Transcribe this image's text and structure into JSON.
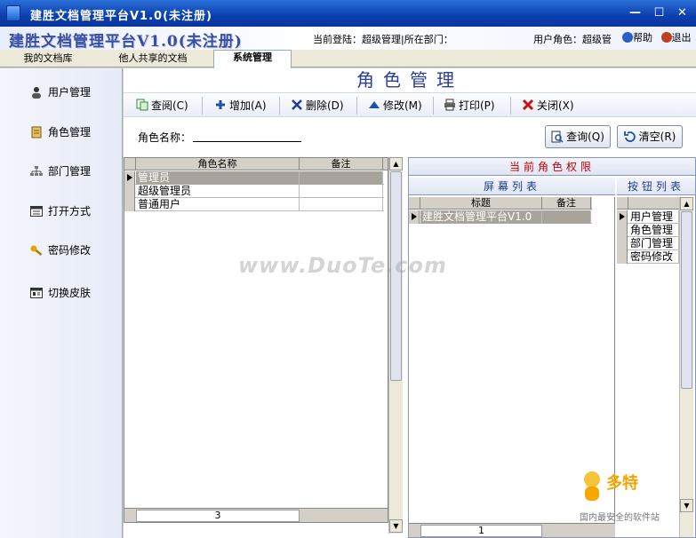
{
  "window": {
    "title": "建胜文档管理平台V1.0(未注册)",
    "min_glyph": "—",
    "max_glyph": "☐",
    "close_glyph": "✕"
  },
  "header": {
    "brand": "建胜文档管理平台V1.0(未注册)",
    "login_label": "当前登陆：",
    "login_user": "超级管理",
    "dept_label": "所在部门：",
    "role_label": "用户角色：",
    "role_value": "超级管",
    "help_label": "帮助",
    "exit_label": "退出"
  },
  "tabs": [
    {
      "label": "我的文档库"
    },
    {
      "label": "他人共享的文档"
    },
    {
      "label": "系统管理"
    }
  ],
  "sidebar": {
    "items": [
      {
        "label": "用户管理",
        "icon": "user-icon"
      },
      {
        "label": "角色管理",
        "icon": "role-icon"
      },
      {
        "label": "部门管理",
        "icon": "org-icon"
      },
      {
        "label": "打开方式",
        "icon": "window-icon"
      },
      {
        "label": "密码修改",
        "icon": "key-icon"
      },
      {
        "label": "切换皮肤",
        "icon": "skin-icon"
      }
    ]
  },
  "page": {
    "title": "角色管理"
  },
  "toolbar": {
    "view": "查阅(C)",
    "add": "增加(A)",
    "delete": "删除(D)",
    "edit": "修改(M)",
    "print": "打印(P)",
    "close": "关闭(X)"
  },
  "search": {
    "label": "角色名称：",
    "value": "",
    "query_button": "查询(Q)",
    "clear_button": "清空(R)"
  },
  "roles_grid": {
    "columns": [
      "角色名称",
      "备注"
    ],
    "rows": [
      {
        "name": "管理员",
        "note": ""
      },
      {
        "name": "超级管理员",
        "note": ""
      },
      {
        "name": "普通用户",
        "note": ""
      }
    ],
    "count": "3"
  },
  "permissions": {
    "header": "当前角色权限",
    "screen_list": {
      "header": "屏幕列表",
      "columns": [
        "标题",
        "备注"
      ],
      "rows": [
        {
          "title": "建胜文档管理平台V1.0",
          "note": ""
        }
      ],
      "count": "1"
    },
    "button_list": {
      "header": "按钮列表",
      "rows": [
        "用户管理",
        "角色管理",
        "部门管理",
        "密码修改"
      ]
    }
  },
  "overlays": {
    "watermark": "www.DuoTe.com",
    "brand_cn": "多特",
    "brand_tag": "国内最安全的软件站"
  },
  "colors": {
    "titlebar": "#0b3fae",
    "accent": "#2a3f9a",
    "perm_header": "#c00000",
    "selection": "#a9a49b"
  }
}
